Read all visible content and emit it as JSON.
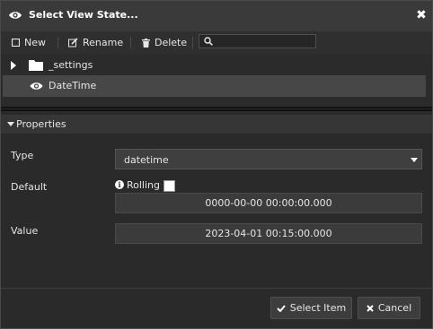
{
  "dialog": {
    "title": "Select View State...",
    "close_glyph": "✖",
    "title_icon": "eye-icon"
  },
  "toolbar": {
    "new_label": "New",
    "rename_label": "Rename",
    "delete_label": "Delete",
    "search_value": "",
    "search_placeholder": ""
  },
  "tree": {
    "items": [
      {
        "label": "_settings",
        "icon": "folder-icon",
        "expandable": true
      },
      {
        "label": "DateTime",
        "icon": "eye-icon",
        "selected": true
      }
    ]
  },
  "properties": {
    "header": "Properties",
    "type_label": "Type",
    "type_value": "datetime",
    "default_label": "Default",
    "rolling_label": "Rolling",
    "rolling_checked": false,
    "default_value": "0000-00-00 00:00:00.000",
    "value_label": "Value",
    "value_value": "2023-04-01 00:15:00.000"
  },
  "footer": {
    "select_label": "Select Item",
    "cancel_label": "Cancel"
  },
  "colors": {
    "background": "#2a2a2a",
    "titlebar": "#3a3a3a",
    "selected_row": "#474747"
  }
}
